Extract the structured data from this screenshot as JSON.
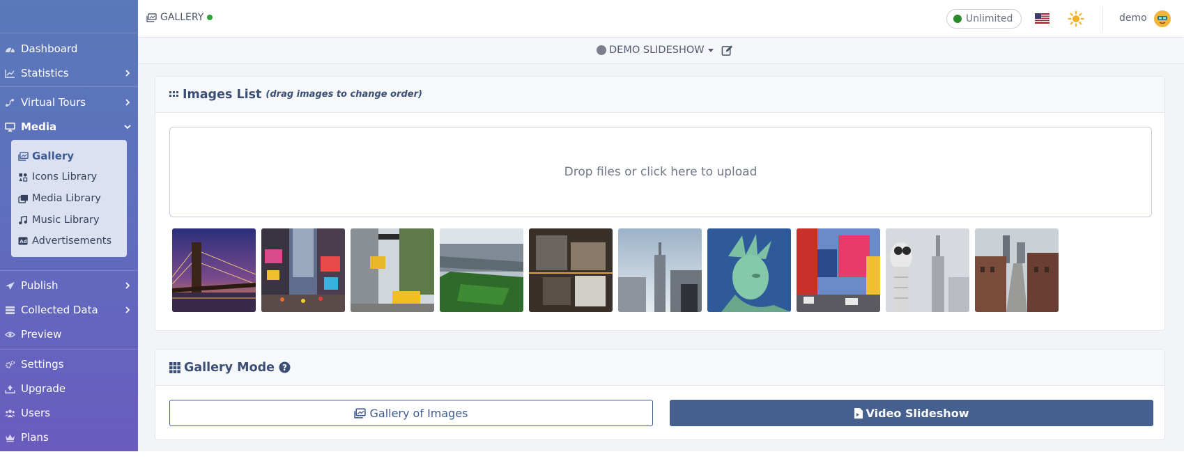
{
  "sidebar": {
    "items": [
      {
        "label": "Dashboard",
        "icon": "gauge-icon"
      },
      {
        "label": "Statistics",
        "icon": "chart-icon",
        "submenu": true
      },
      {
        "label": "Virtual Tours",
        "icon": "route-icon",
        "submenu": true
      },
      {
        "label": "Media",
        "icon": "monitor-icon",
        "submenu": true,
        "expanded": true
      },
      {
        "label": "Publish",
        "icon": "paper-plane-icon",
        "submenu": true
      },
      {
        "label": "Collected Data",
        "icon": "database-icon",
        "submenu": true
      },
      {
        "label": "Preview",
        "icon": "eye-icon"
      },
      {
        "label": "Settings",
        "icon": "cogs-icon"
      },
      {
        "label": "Upgrade",
        "icon": "upgrade-icon"
      },
      {
        "label": "Users",
        "icon": "users-icon"
      },
      {
        "label": "Plans",
        "icon": "crown-icon"
      }
    ],
    "media_submenu": [
      {
        "label": "Gallery",
        "icon": "images-icon",
        "active": true
      },
      {
        "label": "Icons Library",
        "icon": "icons-icon"
      },
      {
        "label": "Media Library",
        "icon": "photo-film-icon"
      },
      {
        "label": "Music Library",
        "icon": "music-icon"
      },
      {
        "label": "Advertisements",
        "icon": "ad-icon"
      }
    ]
  },
  "topbar": {
    "title": "GALLERY",
    "status_color": "#2ba23c",
    "plan_label": "Unlimited",
    "language_flag": "us-flag-icon",
    "theme_icon": "sun-icon",
    "username": "demo"
  },
  "subbar": {
    "tour_name": "DEMO SLIDESHOW"
  },
  "images_card": {
    "title": "Images List",
    "hint": "(drag images to change order)",
    "dropzone_text": "Drop files or click here to upload",
    "images": [
      {
        "subject": "brooklyn-bridge-night"
      },
      {
        "subject": "times-square-street"
      },
      {
        "subject": "street-with-taxi"
      },
      {
        "subject": "central-park-aerial"
      },
      {
        "subject": "rooftops-aerial"
      },
      {
        "subject": "empire-state-skyline"
      },
      {
        "subject": "statue-of-liberty"
      },
      {
        "subject": "times-square-billboards"
      },
      {
        "subject": "binocular-viewer"
      },
      {
        "subject": "city-street-skyline"
      }
    ]
  },
  "mode_card": {
    "title": "Gallery Mode",
    "option_gallery": "Gallery of Images",
    "option_video": "Video Slideshow",
    "selected": "video"
  },
  "colors": {
    "sidebar_top": "#5a79b8",
    "sidebar_bottom": "#6a5bbd",
    "accent": "#45608f",
    "card_title": "#3b4f76"
  }
}
